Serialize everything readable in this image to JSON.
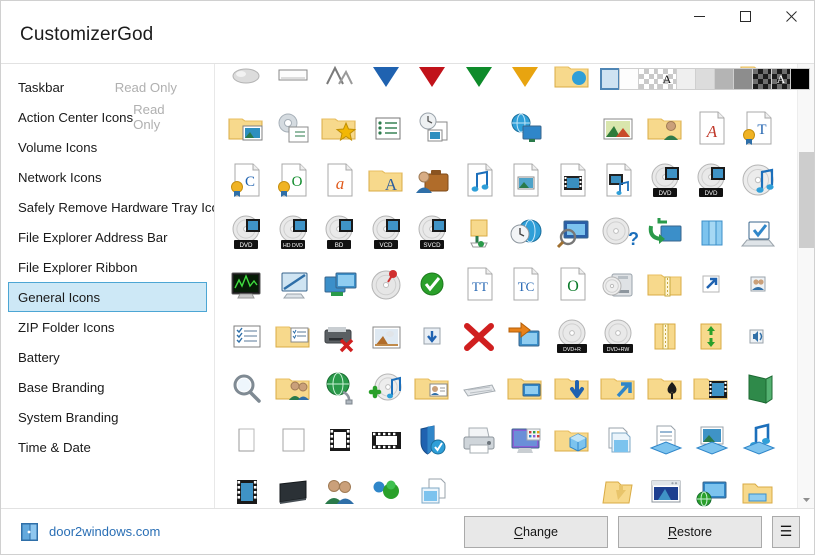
{
  "window": {
    "title": "CustomizerGod",
    "controls": [
      {
        "name": "minimize",
        "glyph": "minimize-icon"
      },
      {
        "name": "maximize",
        "glyph": "maximize-icon"
      },
      {
        "name": "close",
        "glyph": "close-icon"
      }
    ]
  },
  "sidebar": {
    "items": [
      {
        "label": "Taskbar",
        "badge": "Read Only",
        "selected": false
      },
      {
        "label": "Action Center Icons",
        "badge": "Read Only",
        "selected": false
      },
      {
        "label": "Volume Icons",
        "badge": "",
        "selected": false
      },
      {
        "label": "Network Icons",
        "badge": "",
        "selected": false
      },
      {
        "label": "Safely Remove Hardware Tray Icon",
        "badge": "",
        "selected": false
      },
      {
        "label": "File Explorer Address Bar",
        "badge": "",
        "selected": false
      },
      {
        "label": "File Explorer Ribbon",
        "badge": "",
        "selected": false
      },
      {
        "label": "General Icons",
        "badge": "",
        "selected": true
      },
      {
        "label": "ZIP Folder Icons",
        "badge": "",
        "selected": false
      },
      {
        "label": "Battery",
        "badge": "",
        "selected": false
      },
      {
        "label": "Base Branding",
        "badge": "",
        "selected": false
      },
      {
        "label": "System Branding",
        "badge": "",
        "selected": false
      },
      {
        "label": "Time & Date",
        "badge": "",
        "selected": false
      }
    ]
  },
  "palette": {
    "selected_index": 0,
    "swatches": [
      {
        "name": "swatch-light-blue",
        "kind": "solid",
        "color": "#cfe3f2",
        "glyph": ""
      },
      {
        "name": "swatch-white",
        "kind": "solid",
        "color": "#fdfdfd",
        "glyph": ""
      },
      {
        "name": "swatch-light-checker",
        "kind": "checker-light",
        "color": "#ffffff",
        "glyph": ""
      },
      {
        "name": "swatch-light-checker-letter",
        "kind": "checker-light",
        "color": "#ffffff",
        "glyph": "A"
      },
      {
        "name": "swatch-gray-95",
        "kind": "solid",
        "color": "#efefef",
        "glyph": ""
      },
      {
        "name": "swatch-gray-85",
        "kind": "solid",
        "color": "#dcdcdc",
        "glyph": ""
      },
      {
        "name": "swatch-gray-70",
        "kind": "solid",
        "color": "#b4b4b4",
        "glyph": ""
      },
      {
        "name": "swatch-gray-55",
        "kind": "solid",
        "color": "#8d8d8d",
        "glyph": ""
      },
      {
        "name": "swatch-dark-checker",
        "kind": "checker-dark",
        "color": "#6e6e6e",
        "glyph": ""
      },
      {
        "name": "swatch-dark-checker-letter",
        "kind": "checker-dark",
        "color": "#6e6e6e",
        "glyph": "A"
      },
      {
        "name": "swatch-black",
        "kind": "solid",
        "color": "#000000",
        "glyph": ""
      }
    ]
  },
  "icon_grid": {
    "columns": 12,
    "icons": [
      {
        "name": "mouse-icon",
        "kind": "mouse"
      },
      {
        "name": "scrollbar-icon",
        "kind": "bar-outline"
      },
      {
        "name": "mountain-icon",
        "kind": "peak"
      },
      {
        "name": "blue-down-arrow-icon",
        "kind": "tri",
        "color": "#1f62b0"
      },
      {
        "name": "red-down-arrow-icon",
        "kind": "tri",
        "color": "#c1121a"
      },
      {
        "name": "green-down-arrow-icon",
        "kind": "tri",
        "color": "#0e8b2a"
      },
      {
        "name": "yellow-down-arrow-icon",
        "kind": "tri",
        "color": "#e8a410"
      },
      {
        "name": "folder-globe-icon",
        "kind": "folder-badge",
        "color": "#2f9fd8"
      },
      {
        "name": "feather-icon",
        "kind": "feather"
      },
      {
        "name": "blue-bar-icon",
        "kind": "bluebar"
      },
      {
        "name": "red-swoosh-icon",
        "kind": "swoosh"
      },
      {
        "name": "folder-list-icon",
        "kind": "folder-doc"
      },
      {
        "name": "pictures-folder-icon",
        "kind": "folder-photo"
      },
      {
        "name": "settings-checklist-icon",
        "kind": "gear-list"
      },
      {
        "name": "favorites-folder-icon",
        "kind": "folder-star"
      },
      {
        "name": "task-list-icon",
        "kind": "list-doc"
      },
      {
        "name": "recent-items-icon",
        "kind": "clock-docs"
      },
      {
        "name": "empty-slot",
        "kind": "empty"
      },
      {
        "name": "network-display-icon",
        "kind": "globe-screen"
      },
      {
        "name": "empty-slot",
        "kind": "empty"
      },
      {
        "name": "picture-frame-icon",
        "kind": "framed-picture"
      },
      {
        "name": "user-folder-icon",
        "kind": "folder-user"
      },
      {
        "name": "font-file-icon",
        "kind": "doc-letter",
        "letter": "A",
        "color": "#c0392b"
      },
      {
        "name": "truetype-font-icon",
        "kind": "doc-cert-letter",
        "letter": "T",
        "color": "#1f62b0"
      },
      {
        "name": "certificate-type1-icon",
        "kind": "doc-cert-letter",
        "letter": "C",
        "color": "#1f62b0"
      },
      {
        "name": "opentype-font-icon",
        "kind": "doc-cert-letter",
        "letter": "O",
        "color": "#0e8b2a"
      },
      {
        "name": "italic-a-doc-icon",
        "kind": "doc-letter",
        "letter": "a",
        "color": "#e05a1b"
      },
      {
        "name": "fonts-folder-icon",
        "kind": "folder-letter",
        "letter": "A"
      },
      {
        "name": "briefcase-user-icon",
        "kind": "briefcase-user"
      },
      {
        "name": "audio-file-icon",
        "kind": "doc-note"
      },
      {
        "name": "image-file-icon",
        "kind": "doc-image"
      },
      {
        "name": "video-file-icon",
        "kind": "doc-film"
      },
      {
        "name": "media-file-icon",
        "kind": "doc-film-note"
      },
      {
        "name": "dvd-video-disc-icon",
        "kind": "disc-label-film",
        "label": "DVD"
      },
      {
        "name": "dvd-disc-icon",
        "kind": "disc-label-film",
        "label": "DVD"
      },
      {
        "name": "audio-cd-icon",
        "kind": "disc-note"
      },
      {
        "name": "dvd-drive-icon",
        "kind": "disc-label-film",
        "label": "DVD"
      },
      {
        "name": "hd-dvd-drive-icon",
        "kind": "disc-label-film",
        "label": "HD DVD"
      },
      {
        "name": "bluray-drive-icon",
        "kind": "disc-label-film",
        "label": "BD"
      },
      {
        "name": "vcd-drive-icon",
        "kind": "disc-label-film",
        "label": "VCD"
      },
      {
        "name": "svcd-drive-icon",
        "kind": "disc-label-film",
        "label": "SVCD"
      },
      {
        "name": "burn-folder-icon",
        "kind": "folder-burn"
      },
      {
        "name": "world-clock-icon",
        "kind": "globe-clock"
      },
      {
        "name": "screen-search-icon",
        "kind": "screen-search"
      },
      {
        "name": "disc-help-icon",
        "kind": "disc-question"
      },
      {
        "name": "sync-screen-icon",
        "kind": "sync-screens"
      },
      {
        "name": "books-icon",
        "kind": "books"
      },
      {
        "name": "laptop-check-icon",
        "kind": "laptop-check"
      },
      {
        "name": "performance-monitor-icon",
        "kind": "monitor-graph"
      },
      {
        "name": "remote-desktop-icon",
        "kind": "screen-cable"
      },
      {
        "name": "multi-display-icon",
        "kind": "dual-screens"
      },
      {
        "name": "burn-disc-icon",
        "kind": "disc-burn"
      },
      {
        "name": "success-check-icon",
        "kind": "check-circle"
      },
      {
        "name": "truetype-doc-icon",
        "kind": "doc-letter2",
        "letter": "TT",
        "color": "#1f62b0"
      },
      {
        "name": "type1-doc-icon",
        "kind": "doc-letter2",
        "letter": "TC",
        "color": "#1f62b0"
      },
      {
        "name": "opentype-doc-icon",
        "kind": "doc-letter2",
        "letter": "O",
        "color": "#0b7a2a"
      },
      {
        "name": "disc-burner-icon",
        "kind": "drive-disc"
      },
      {
        "name": "zip-folder-icon",
        "kind": "folder-zip"
      },
      {
        "name": "shortcut-arrow-icon",
        "kind": "shortcut-badge"
      },
      {
        "name": "small-users-icon",
        "kind": "small-users"
      },
      {
        "name": "checklist-doc-icon",
        "kind": "doc-checklist"
      },
      {
        "name": "tasks-folder-icon",
        "kind": "folder-checklist"
      },
      {
        "name": "disconnected-drive-icon",
        "kind": "drive-x"
      },
      {
        "name": "paint-picture-icon",
        "kind": "paint-pic"
      },
      {
        "name": "download-arrow-icon",
        "kind": "arrow-down-box"
      },
      {
        "name": "delete-x-icon",
        "kind": "red-x"
      },
      {
        "name": "transfer-screens-icon",
        "kind": "screens-arrow"
      },
      {
        "name": "dvd-plus-r-icon",
        "kind": "disc-label",
        "label": "DVD+R"
      },
      {
        "name": "dvd-plus-rw-icon",
        "kind": "disc-label",
        "label": "DVD+RW"
      },
      {
        "name": "compressed-folder-icon",
        "kind": "folder-zipper"
      },
      {
        "name": "extract-folder-icon",
        "kind": "folder-extract"
      },
      {
        "name": "speaker-icon",
        "kind": "speaker-small"
      },
      {
        "name": "search-icon",
        "kind": "magnifier"
      },
      {
        "name": "shared-folder-icon",
        "kind": "folder-users"
      },
      {
        "name": "network-globe-icon",
        "kind": "globe-plug"
      },
      {
        "name": "add-music-disc-icon",
        "kind": "disc-plus-note"
      },
      {
        "name": "contacts-folder-icon",
        "kind": "folder-card"
      },
      {
        "name": "keyboard-icon",
        "kind": "keyboard"
      },
      {
        "name": "desktop-folder-icon",
        "kind": "folder-desktop"
      },
      {
        "name": "downloads-folder-icon",
        "kind": "folder-download"
      },
      {
        "name": "links-folder-icon",
        "kind": "folder-link"
      },
      {
        "name": "games-folder-icon",
        "kind": "folder-spade"
      },
      {
        "name": "videos-folder-icon",
        "kind": "folder-film"
      },
      {
        "name": "open-book-icon",
        "kind": "green-book"
      },
      {
        "name": "blank-page-icon",
        "kind": "blank-corner"
      },
      {
        "name": "blank-square-icon",
        "kind": "blank-square"
      },
      {
        "name": "film-strip-icon",
        "kind": "film-portrait"
      },
      {
        "name": "film-strip-wide-icon",
        "kind": "film-landscape"
      },
      {
        "name": "security-shield-icon",
        "kind": "shield-blue"
      },
      {
        "name": "printer-icon",
        "kind": "printer"
      },
      {
        "name": "desktop-apps-icon",
        "kind": "monitor-tiles"
      },
      {
        "name": "3d-objects-folder-icon",
        "kind": "folder-cube"
      },
      {
        "name": "copy-files-icon",
        "kind": "copy-pages"
      },
      {
        "name": "document-stack-icon",
        "kind": "doc-stack"
      },
      {
        "name": "photo-stack-icon",
        "kind": "photo-stack"
      },
      {
        "name": "music-stack-icon",
        "kind": "note-stack"
      },
      {
        "name": "movie-reel-icon",
        "kind": "film-portrait2"
      },
      {
        "name": "tv-icon",
        "kind": "tv-dark"
      },
      {
        "name": "users-group-icon",
        "kind": "two-users"
      },
      {
        "name": "messenger-icon",
        "kind": "messenger"
      },
      {
        "name": "page-preview-icon",
        "kind": "page-preview"
      },
      {
        "name": "empty-slot",
        "kind": "empty"
      },
      {
        "name": "empty-slot",
        "kind": "empty"
      },
      {
        "name": "empty-slot",
        "kind": "empty"
      },
      {
        "name": "folder-ribbon-icon",
        "kind": "folder-arrowup"
      },
      {
        "name": "window-preview-icon",
        "kind": "window-preview"
      },
      {
        "name": "screen-globe-icon",
        "kind": "screen-globe"
      },
      {
        "name": "open-folder-icon",
        "kind": "folder-open2"
      }
    ]
  },
  "scrollbar": {
    "up_arrow": "scroll-up-icon",
    "down_arrow": "scroll-down-icon"
  },
  "footer": {
    "brand": "door2windows.com",
    "change_label": "Change",
    "change_accel": "C",
    "restore_label": "Restore",
    "restore_accel": "R",
    "menu_glyph": "☰"
  },
  "colors": {
    "accent": "#2a6fb5",
    "selection_bg": "#cde8f6",
    "selection_border": "#4ca6d4",
    "folder": "#f5d78a",
    "window_bg": "#ffffff"
  }
}
